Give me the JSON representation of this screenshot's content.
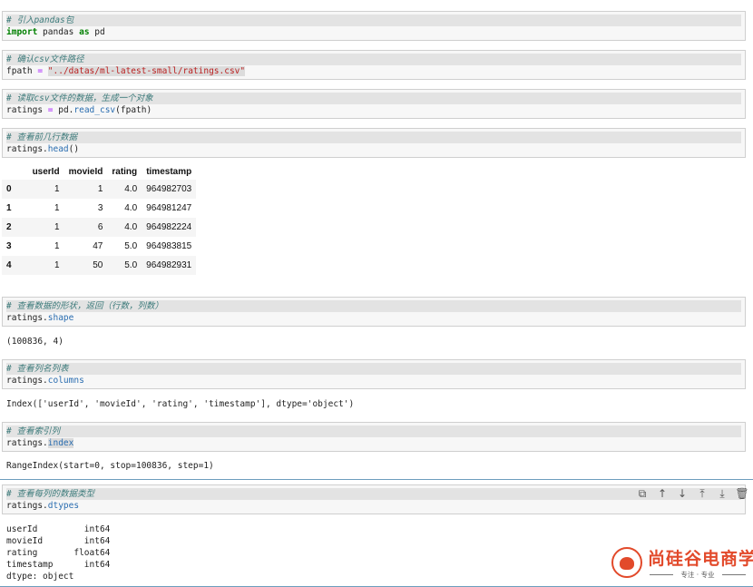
{
  "cells": [
    {
      "comment": "# 引入pandas包",
      "code": {
        "kw": "import",
        "mid": " pandas ",
        "kw2": "as",
        "end": " pd"
      }
    },
    {
      "comment": "# 确认csv文件路径",
      "code": {
        "var": "fpath",
        "op": " = ",
        "str": "\"../datas/ml-latest-small/ratings.csv\""
      }
    },
    {
      "comment": "# 读取csv文件的数据，生成一个对象",
      "code": {
        "var": "ratings",
        "op": " = ",
        "obj": "pd.",
        "attr": "read_csv",
        "args": "(fpath)"
      }
    },
    {
      "comment": "# 查看前几行数据",
      "code": {
        "obj": "ratings.",
        "attr": "head",
        "args": "()"
      }
    },
    {
      "comment": "# 查看数据的形状，返回（行数，列数）",
      "code": {
        "obj": "ratings.",
        "attr": "shape"
      },
      "output": "(100836, 4)"
    },
    {
      "comment": "# 查看列名列表",
      "code": {
        "obj": "ratings.",
        "attr": "columns"
      },
      "output": "Index(['userId', 'movieId', 'rating', 'timestamp'], dtype='object')"
    },
    {
      "comment": "# 查看索引列",
      "code": {
        "obj": "ratings.",
        "attr": "index"
      },
      "output": "RangeIndex(start=0, stop=100836, step=1)"
    },
    {
      "comment": "# 查看每列的数据类型",
      "code": {
        "obj": "ratings.",
        "attr": "dtypes"
      },
      "output": "userId         int64\nmovieId        int64\nrating       float64\ntimestamp      int64\ndtype: object"
    }
  ],
  "dataframe": {
    "columns": [
      "",
      "userId",
      "movieId",
      "rating",
      "timestamp"
    ],
    "rows": [
      [
        "0",
        "1",
        "1",
        "4.0",
        "964982703"
      ],
      [
        "1",
        "1",
        "3",
        "4.0",
        "964981247"
      ],
      [
        "2",
        "1",
        "6",
        "4.0",
        "964982224"
      ],
      [
        "3",
        "1",
        "47",
        "5.0",
        "964983815"
      ],
      [
        "4",
        "1",
        "50",
        "5.0",
        "964982931"
      ]
    ]
  },
  "toolbar": {
    "duplicate_icon": "copy-icon",
    "move_up_icon": "arrow-up-icon",
    "move_down_icon": "arrow-down-icon",
    "insert_above_icon": "insert-above-icon",
    "insert_below_icon": "insert-below-icon",
    "delete_icon": "trash-icon"
  },
  "watermark": {
    "title": "尚硅谷电商学院",
    "subtitle": "专注 · 专业"
  },
  "colors": {
    "accent": "#e24a2b",
    "selection": "#6d9dbd",
    "comment": "#3d7b7b",
    "keyword": "#008000",
    "string": "#ba2121"
  }
}
